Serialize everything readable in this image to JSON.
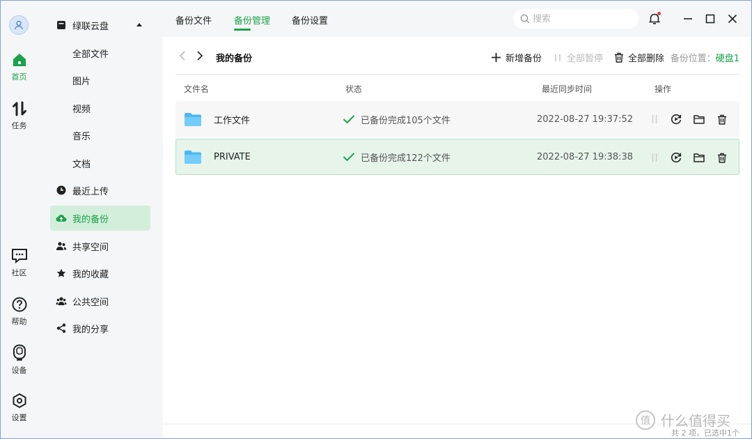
{
  "rail": {
    "items": [
      {
        "label": "首页",
        "icon": "home-icon",
        "active": true
      },
      {
        "label": "任务",
        "icon": "transfer-icon"
      },
      {
        "label": "社区",
        "icon": "chat-icon"
      },
      {
        "label": "帮助",
        "icon": "help-icon"
      },
      {
        "label": "设备",
        "icon": "device-icon"
      },
      {
        "label": "设置",
        "icon": "settings-icon"
      }
    ]
  },
  "sidebar": {
    "header": "绿联云盘",
    "subitems": [
      "全部文件",
      "图片",
      "视频",
      "音乐",
      "文档"
    ],
    "items": [
      {
        "label": "最近上传",
        "icon": "clock-icon"
      },
      {
        "label": "我的备份",
        "icon": "cloud-backup-icon",
        "active": true
      },
      {
        "label": "共享空间",
        "icon": "people-icon"
      },
      {
        "label": "我的收藏",
        "icon": "star-icon"
      },
      {
        "label": "公共空间",
        "icon": "group-icon"
      },
      {
        "label": "我的分享",
        "icon": "share-icon"
      }
    ]
  },
  "tabs": [
    "备份文件",
    "备份管理",
    "备份设置"
  ],
  "active_tab": "备份管理",
  "search": {
    "placeholder": "搜索"
  },
  "toolbar": {
    "breadcrumb": "我的备份",
    "add_label": "新增备份",
    "pause_all_label": "全部暂停",
    "delete_all_label": "全部删除",
    "location_label": "备份位置：",
    "location_value": "硬盘1"
  },
  "table": {
    "columns": [
      "文件名",
      "状态",
      "最近同步时间",
      "操作"
    ],
    "rows": [
      {
        "name": "工作文件",
        "status": "已备份完成105个文件",
        "time": "2022-08-27 19:37:52",
        "selected": false
      },
      {
        "name": "PRIVATE",
        "status": "已备份完成122个文件",
        "time": "2022-08-27 19:38:38",
        "selected": true
      }
    ]
  },
  "footer": {
    "summary": "共 2 项，已选中1个"
  },
  "watermark": {
    "text": "什么值得买",
    "icon_text": "值"
  },
  "colors": {
    "accent": "#1aa14a",
    "selected_bg": "#e6f4ea",
    "folder": "#5cc1f5",
    "sidebar_bg": "#f5f6f7"
  }
}
